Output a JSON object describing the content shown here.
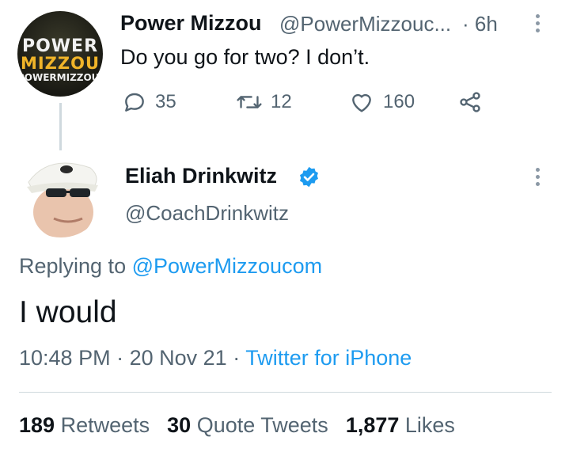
{
  "parent_tweet": {
    "avatar_logo": {
      "line1": "POWER",
      "line2": "MIZZOU",
      "line3": "POWERMIZZOU.COM"
    },
    "display_name": "Power Mizzou",
    "handle": "@PowerMizzouc...",
    "separator": "·",
    "time": "6h",
    "text": "Do you go for two? I don’t.",
    "replies": "35",
    "retweets": "12",
    "likes": "160",
    "icons": [
      "reply-icon",
      "retweet-icon",
      "like-icon",
      "share-icon",
      "more-icon"
    ]
  },
  "main_tweet": {
    "display_name": "Eliah Drinkwitz",
    "handle": "@CoachDrinkwitz",
    "replying_prefix": "Replying to",
    "replying_to": "@PowerMizzoucom",
    "text": "I would",
    "time": "10:48 PM",
    "date": "20 Nov 21",
    "client": "Twitter for iPhone",
    "meta_separator": "·",
    "icons": [
      "verified-icon",
      "more-icon"
    ]
  },
  "stats": [
    {
      "count": "189",
      "label": "Retweets"
    },
    {
      "count": "30",
      "label": "Quote Tweets"
    },
    {
      "count": "1,877",
      "label": "Likes"
    }
  ],
  "colors": {
    "accent": "#1d9bf0",
    "secondary_text": "#536471",
    "primary_text": "#0f1419",
    "divider": "#cfd9de",
    "logo_gold": "#f0b429"
  }
}
